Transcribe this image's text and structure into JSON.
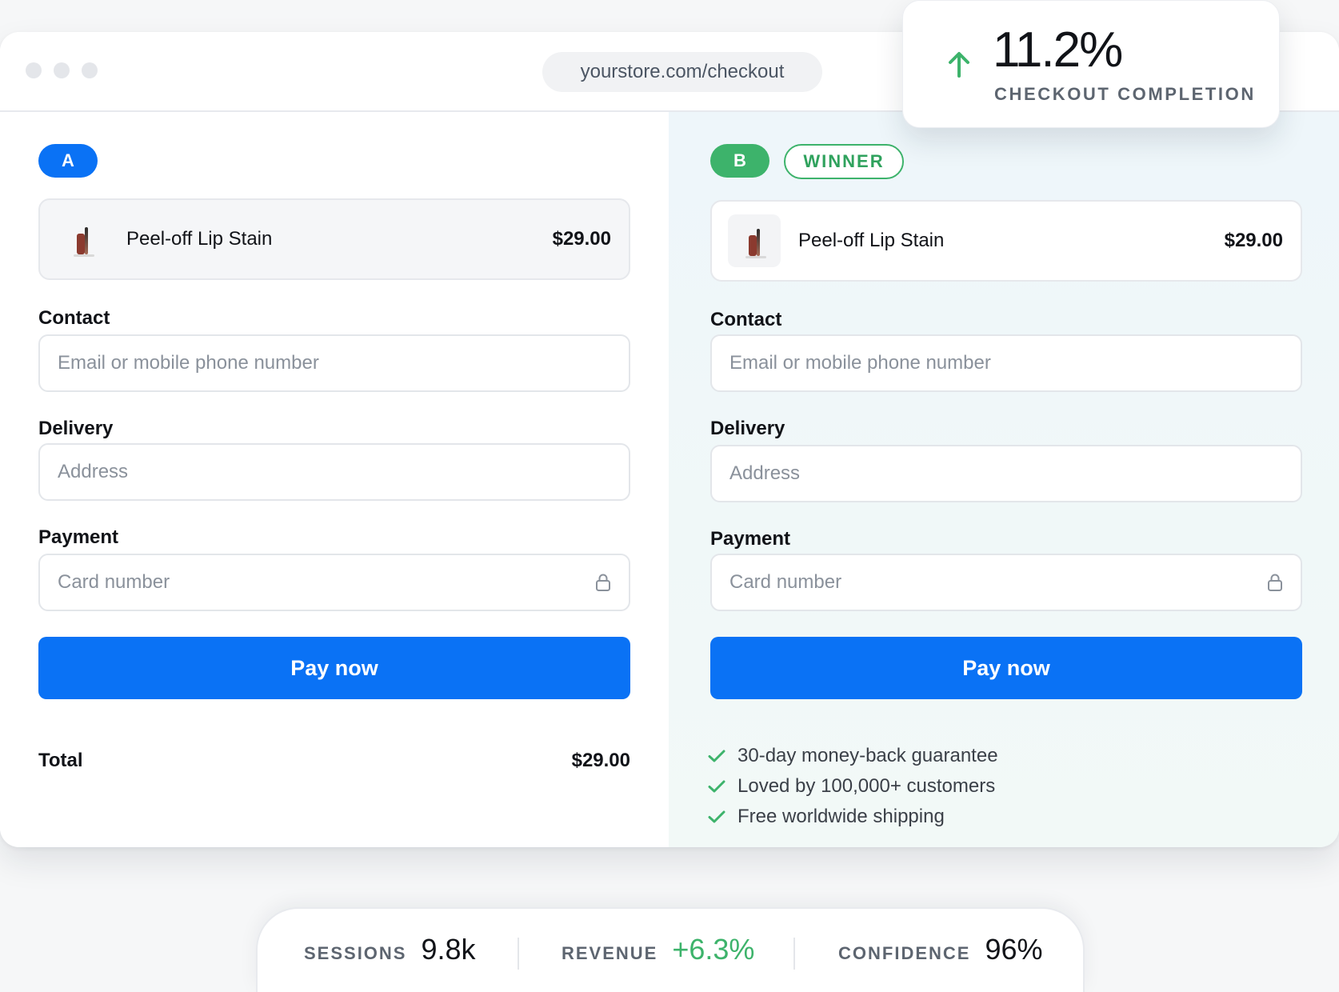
{
  "browser": {
    "url": "yourstore.com/checkout"
  },
  "completion": {
    "value": "11.2%",
    "label": "CHECKOUT COMPLETION",
    "trend": "up",
    "trend_color": "#3db36b"
  },
  "variant_a": {
    "badge": "A",
    "product": {
      "name": "Peel-off Lip Stain",
      "price": "$29.00"
    },
    "contact_label": "Contact",
    "contact_placeholder": "Email or mobile phone number",
    "delivery_label": "Delivery",
    "address_placeholder": "Address",
    "payment_label": "Payment",
    "card_placeholder": "Card number",
    "pay_button": "Pay now",
    "total_label": "Total",
    "total_value": "$29.00"
  },
  "variant_b": {
    "badge": "B",
    "winner_badge": "WINNER",
    "product": {
      "name": "Peel-off Lip Stain",
      "price": "$29.00"
    },
    "contact_label": "Contact",
    "contact_placeholder": "Email or mobile phone number",
    "delivery_label": "Delivery",
    "address_placeholder": "Address",
    "payment_label": "Payment",
    "card_placeholder": "Card number",
    "pay_button": "Pay now",
    "perks": [
      "30-day money-back guarantee",
      "Loved by 100,000+ customers",
      "Free worldwide shipping"
    ]
  },
  "stats": {
    "sessions_label": "SESSIONS",
    "sessions_value": "9.8k",
    "revenue_label": "REVENUE",
    "revenue_value": "+6.3%",
    "confidence_label": "CONFIDENCE",
    "confidence_value": "96%"
  },
  "colors": {
    "primary": "#0a72f5",
    "success": "#3db36b"
  }
}
